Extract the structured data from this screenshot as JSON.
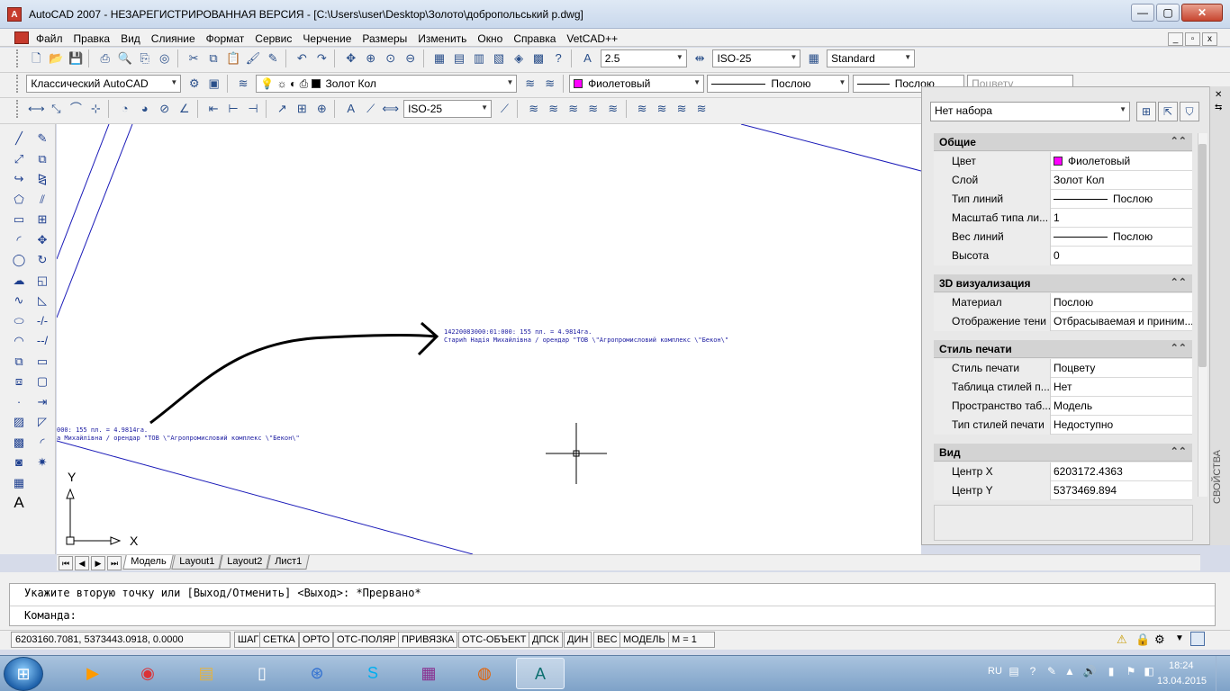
{
  "title": "AutoCAD 2007 - НЕЗАРЕГИСТРИРОВАННАЯ ВЕРСИЯ - [C:\\Users\\user\\Desktop\\Золото\\добропольський р.dwg]",
  "app_icon_glyph": "A",
  "window_buttons": {
    "minimize": "—",
    "restore": "▢",
    "close": "✕"
  },
  "menu": [
    "Файл",
    "Правка",
    "Вид",
    "Слияние",
    "Формат",
    "Сервис",
    "Черчение",
    "Размеры",
    "Изменить",
    "Окно",
    "Справка",
    "VetCAD++"
  ],
  "mdi_buttons": [
    "_",
    "▫",
    "x"
  ],
  "toolbar1": {
    "text_height": "2.5",
    "dim_style": "ISO-25",
    "table_style": "Standard"
  },
  "toolbar2": {
    "workspace": "Классический AutoCAD",
    "layer": "Золот Кол",
    "color": "Фиолетовый",
    "linetype": "Послою",
    "lineweight": "Послою",
    "plotstyle": "Поцвету"
  },
  "toolbar3": {
    "dim_style": "ISO-25"
  },
  "drawing": {
    "text1_line1": "14220083000:01:000: 155 пл. = 4.9814га.",
    "text1_line2": "Стариh Надія Михайлівна /  орендар  \"ТОВ \\\"Агропромисловий комплекс \\\"Бекон\\\"",
    "text2_line1": "000: 155 пл. = 4.9814га.",
    "text2_line2": "а Михайлівна /  орендар  \"ТОВ \\\"Агропромисловий комплекс \\\"Бекон\\\"",
    "ucs_y": "Y",
    "ucs_x": "X"
  },
  "tabs": [
    "Модель",
    "Layout1",
    "Layout2",
    "Лист1"
  ],
  "tab_nav": [
    "⏮",
    "◀",
    "▶",
    "⏭"
  ],
  "command": {
    "line1": "Укажите вторую точку или [Выход/Отменить] <Выход>: *Прервано*",
    "line2": "Команда:"
  },
  "status": {
    "coords": "6203160.7081, 5373443.0918, 0.0000",
    "buttons": [
      "ШАГ",
      "СЕТКА",
      "ОРТО",
      "ОТС-ПОЛЯР",
      "ПРИВЯЗКА",
      "ОТС-ОБЪЕКТ",
      "ДПСК",
      "ДИН",
      "ВЕС",
      "МОДЕЛЬ"
    ],
    "scale": "M = 1"
  },
  "properties": {
    "selection": "Нет набора",
    "vertical_title": "СВОЙСТВА",
    "sections": {
      "general": {
        "title": "Общие",
        "rows": [
          {
            "name": "Цвет",
            "value": "Фиолетовый"
          },
          {
            "name": "Слой",
            "value": "Золот Кол"
          },
          {
            "name": "Тип линий",
            "value": "Послою"
          },
          {
            "name": "Масштаб типа ли...",
            "value": "1"
          },
          {
            "name": "Вес линий",
            "value": "Послою"
          },
          {
            "name": "Высота",
            "value": "0"
          }
        ]
      },
      "viz3d": {
        "title": "3D визуализация",
        "rows": [
          {
            "name": "Материал",
            "value": "Послою"
          },
          {
            "name": "Отображение тени",
            "value": "Отбрасываемая и приним..."
          }
        ]
      },
      "plot": {
        "title": "Стиль печати",
        "rows": [
          {
            "name": "Стиль печати",
            "value": "Поцвету"
          },
          {
            "name": "Таблица стилей п...",
            "value": "Нет"
          },
          {
            "name": "Пространство таб...",
            "value": "Модель"
          },
          {
            "name": "Тип стилей печати",
            "value": "Недоступно"
          }
        ]
      },
      "view": {
        "title": "Вид",
        "rows": [
          {
            "name": "Центр X",
            "value": "6203172.4363"
          },
          {
            "name": "Центр Y",
            "value": "5373469.894"
          }
        ]
      }
    }
  },
  "colors": {
    "layer_color": "#ff00ff",
    "cad_lines": "#1a1ab8"
  },
  "taskbar": {
    "start_glyph": "⊞",
    "apps": [
      "media-player-icon",
      "chrome-icon",
      "explorer-icon",
      "document-icon",
      "network-icon",
      "skype-icon",
      "winrar-icon",
      "firefox-icon",
      "autocad-icon"
    ],
    "lang": "RU",
    "time": "18:24",
    "date": "13.04.2015"
  }
}
